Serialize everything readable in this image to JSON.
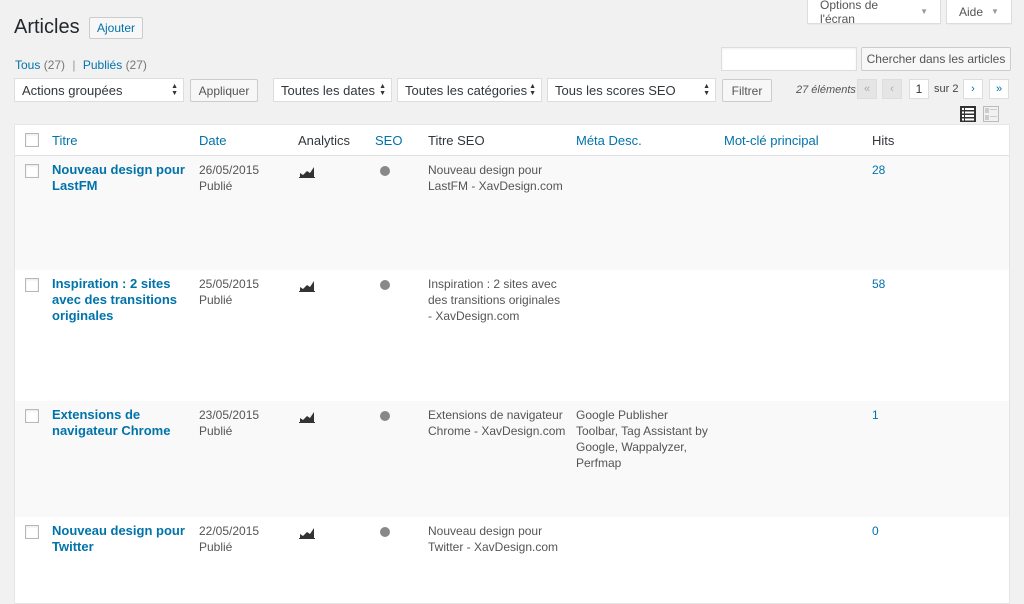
{
  "header": {
    "screen_options": "Options de l'écran",
    "help": "Aide",
    "title": "Articles",
    "add_new": "Ajouter"
  },
  "filters": {
    "all_label": "Tous",
    "all_count": "(27)",
    "published_label": "Publiés",
    "published_count": "(27)",
    "separator": "|"
  },
  "search": {
    "value": "",
    "button": "Chercher dans les articles"
  },
  "toolbar": {
    "bulk_actions": "Actions groupées",
    "apply": "Appliquer",
    "dates": "Toutes les dates",
    "categories": "Toutes les catégories",
    "seo_scores": "Tous les scores SEO",
    "filter": "Filtrer"
  },
  "pagination": {
    "items": "27 éléments",
    "first": "«",
    "prev": "‹",
    "current": "1",
    "of": "sur 2",
    "next": "›",
    "last": "»"
  },
  "columns": {
    "title": "Titre",
    "date": "Date",
    "analytics": "Analytics",
    "seo": "SEO",
    "seo_title": "Titre SEO",
    "meta_desc": "Méta Desc.",
    "focus_kw": "Mot-clé principal",
    "hits": "Hits"
  },
  "rows": [
    {
      "title_lines": [
        "Nouveau design pour",
        "LastFM"
      ],
      "date": "26/05/2015",
      "status": "Publié",
      "seo_title_lines": [
        "Nouveau design pour",
        "LastFM - XavDesign.com"
      ],
      "meta_lines": [],
      "hits": "28"
    },
    {
      "title_lines": [
        "Inspiration : 2 sites",
        "avec des transitions",
        "originales"
      ],
      "date": "25/05/2015",
      "status": "Publié",
      "seo_title_lines": [
        "Inspiration : 2 sites avec",
        "des transitions originales",
        "- XavDesign.com"
      ],
      "meta_lines": [],
      "hits": "58"
    },
    {
      "title_lines": [
        "Extensions de",
        "navigateur Chrome"
      ],
      "date": "23/05/2015",
      "status": "Publié",
      "seo_title_lines": [
        "Extensions de navigateur",
        "Chrome - XavDesign.com"
      ],
      "meta_lines": [
        "Google Publisher",
        "Toolbar, Tag Assistant by",
        "Google, Wappalyzer,",
        "Perfmap"
      ],
      "hits": "1"
    },
    {
      "title_lines": [
        "Nouveau design pour",
        "Twitter"
      ],
      "date": "22/05/2015",
      "status": "Publié",
      "seo_title_lines": [
        "Nouveau design pour",
        "Twitter - XavDesign.com"
      ],
      "meta_lines": [],
      "hits": "0"
    }
  ],
  "colors": {
    "link": "#0073aa",
    "seo_dot": "#888888"
  }
}
